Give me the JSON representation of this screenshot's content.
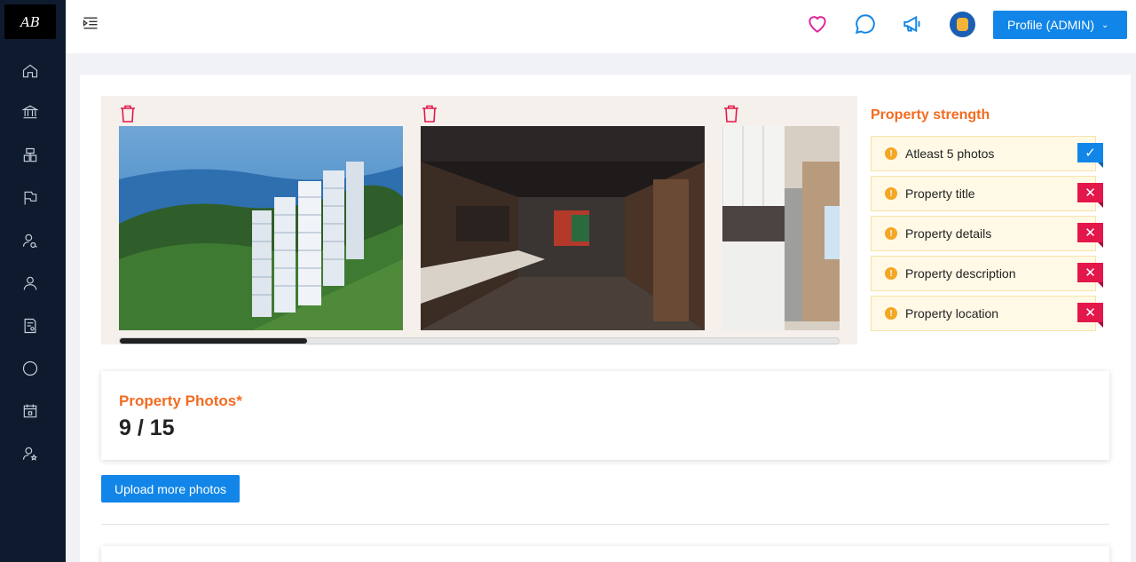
{
  "app": {
    "logo_text": "AB"
  },
  "sidebar": {
    "items": [
      {
        "icon": "home-icon"
      },
      {
        "icon": "bank-icon"
      },
      {
        "icon": "building-icon"
      },
      {
        "icon": "flag-icon"
      },
      {
        "icon": "user-search-icon"
      },
      {
        "icon": "user-icon"
      },
      {
        "icon": "document-icon"
      },
      {
        "icon": "chat-icon"
      },
      {
        "icon": "calendar-icon"
      },
      {
        "icon": "user-settings-icon"
      }
    ]
  },
  "header": {
    "icons": [
      "heart-icon",
      "chat-bubble-icon",
      "megaphone-icon"
    ],
    "profile_label": "Profile (ADMIN)",
    "colors": {
      "heart": "#e0249a",
      "primary": "#1186e8"
    }
  },
  "gallery": {
    "photos": [
      {
        "name": "aerial-view-photo",
        "alt": "Aerial view of resort towers by the lake"
      },
      {
        "name": "kitchen-interior-photo",
        "alt": "Dark wood kitchen and living area"
      },
      {
        "name": "white-kitchen-photo",
        "alt": "White kitchen with balcony"
      }
    ],
    "scroll_position": 0.26
  },
  "strength": {
    "title": "Property strength",
    "items": [
      {
        "label": "Atleast 5 photos",
        "status": "done"
      },
      {
        "label": "Property title",
        "status": "missing"
      },
      {
        "label": "Property details",
        "status": "missing"
      },
      {
        "label": "Property description",
        "status": "missing"
      },
      {
        "label": "Property location",
        "status": "missing"
      }
    ]
  },
  "photos": {
    "title": "Property Photos*",
    "count": "9 / 15"
  },
  "upload_label": "Upload more photos",
  "colors": {
    "accent": "#f26b21",
    "danger": "#e3174a",
    "sidebar": "#0e1b2e"
  }
}
